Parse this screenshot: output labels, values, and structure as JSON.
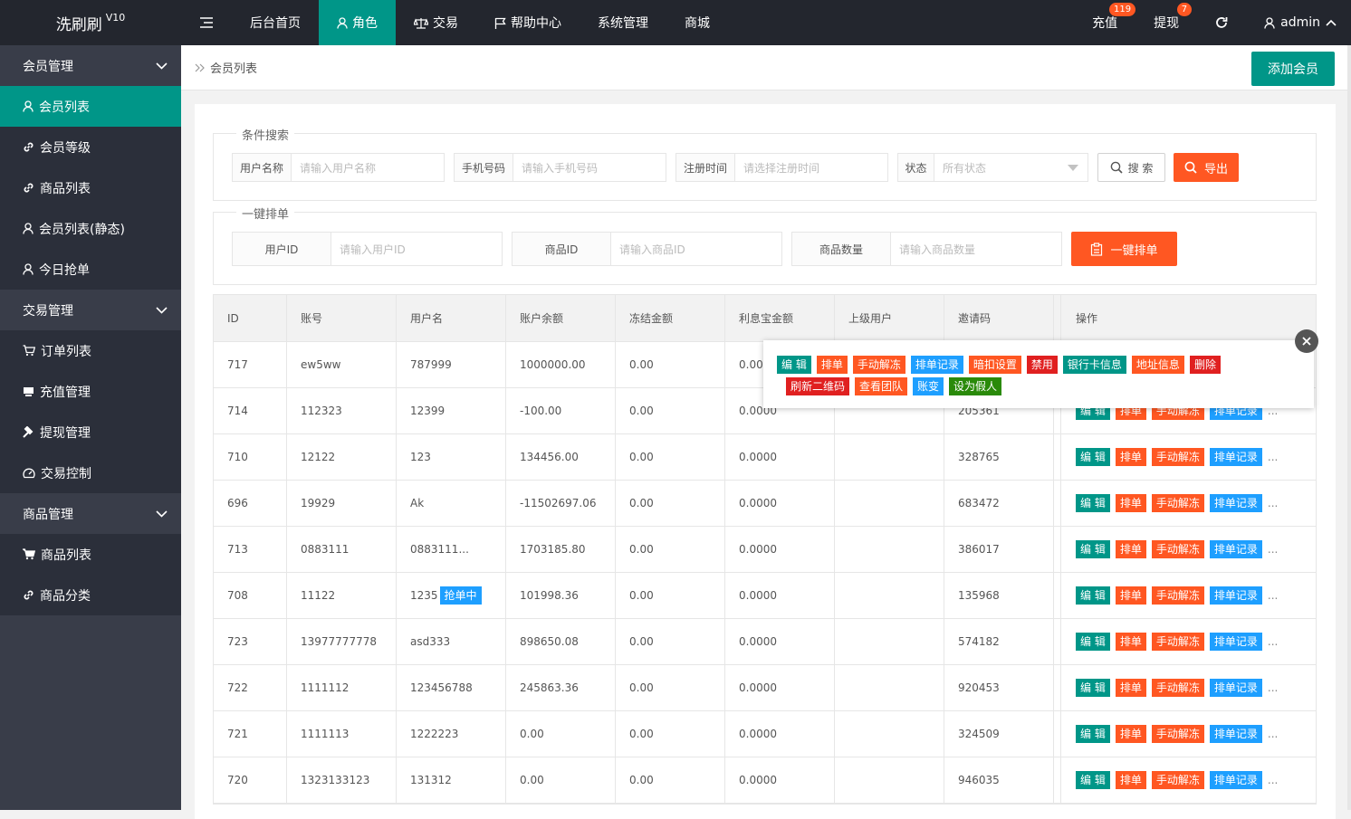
{
  "app": {
    "title": "洗刷刷",
    "version": "V10"
  },
  "nav": [
    {
      "label": "后台首页",
      "icon": ""
    },
    {
      "label": "角色",
      "icon": "user-icon",
      "active": true
    },
    {
      "label": "交易",
      "icon": "scale-icon"
    },
    {
      "label": "帮助中心",
      "icon": "flag-icon"
    },
    {
      "label": "系统管理",
      "icon": ""
    },
    {
      "label": "商城",
      "icon": ""
    }
  ],
  "right_nav": {
    "recharge": {
      "label": "充值",
      "badge": "119"
    },
    "withdraw": {
      "label": "提现",
      "badge": "7"
    },
    "user": "admin"
  },
  "sidebar": {
    "groups": [
      {
        "label": "会员管理",
        "items": [
          {
            "label": "会员列表",
            "icon": "user-icon",
            "active": true
          },
          {
            "label": "会员等级",
            "icon": "link-icon"
          },
          {
            "label": "商品列表",
            "icon": "link-icon"
          },
          {
            "label": "会员列表(静态)",
            "icon": "user-icon"
          },
          {
            "label": "今日抢单",
            "icon": "user-icon"
          }
        ]
      },
      {
        "label": "交易管理",
        "items": [
          {
            "label": "订单列表",
            "icon": "cart-icon"
          },
          {
            "label": "充值管理",
            "icon": "card-icon"
          },
          {
            "label": "提现管理",
            "icon": "hammer-icon"
          },
          {
            "label": "交易控制",
            "icon": "gauge-icon"
          }
        ]
      },
      {
        "label": "商品管理",
        "items": [
          {
            "label": "商品列表",
            "icon": "cart-solid-icon"
          },
          {
            "label": "商品分类",
            "icon": "link-icon"
          }
        ]
      }
    ]
  },
  "breadcrumb": "会员列表",
  "add_button": "添加会员",
  "search": {
    "legend": "条件搜索",
    "fields": [
      {
        "label": "用户名称",
        "placeholder": "请输入用户名称"
      },
      {
        "label": "手机号码",
        "placeholder": "请输入手机号码"
      },
      {
        "label": "注册时间",
        "placeholder": "请选择注册时间"
      },
      {
        "label": "状态",
        "placeholder": "所有状态"
      }
    ],
    "search_button": "搜 索",
    "export_button": "导出"
  },
  "oneclick": {
    "legend": "一键排单",
    "fields": [
      {
        "label": "用户ID",
        "placeholder": "请输入用户ID"
      },
      {
        "label": "商品ID",
        "placeholder": "请输入商品ID"
      },
      {
        "label": "商品数量",
        "placeholder": "请输入商品数量"
      }
    ],
    "button": "一键排单"
  },
  "table": {
    "headers": [
      "ID",
      "账号",
      "用户名",
      "账户余额",
      "冻结金额",
      "利息宝金额",
      "上级用户",
      "邀请码",
      "操作"
    ],
    "rows": [
      {
        "id": "717",
        "account": "ew5ww",
        "username": "787999",
        "balance": "1000000.00",
        "frozen": "0.00",
        "interest": "0.000",
        "parent": "",
        "invite": ""
      },
      {
        "id": "714",
        "account": "112323",
        "username": "12399",
        "balance": "-100.00",
        "frozen": "0.00",
        "interest": "0.0000",
        "parent": "",
        "invite": "205361"
      },
      {
        "id": "710",
        "account": "12122",
        "username": "123",
        "balance": "134456.00",
        "frozen": "0.00",
        "interest": "0.0000",
        "parent": "",
        "invite": "328765"
      },
      {
        "id": "696",
        "account": "19929",
        "username": "Ak",
        "balance": "-11502697.06",
        "frozen": "0.00",
        "interest": "0.0000",
        "parent": "",
        "invite": "683472"
      },
      {
        "id": "713",
        "account": "0883111",
        "username": "0883111...",
        "balance": "1703185.80",
        "frozen": "0.00",
        "interest": "0.0000",
        "parent": "",
        "invite": "386017"
      },
      {
        "id": "708",
        "account": "11122",
        "username": "1235",
        "tag": "抢单中",
        "balance": "101998.36",
        "frozen": "0.00",
        "interest": "0.0000",
        "parent": "",
        "invite": "135968"
      },
      {
        "id": "723",
        "account": "13977777778",
        "username": "asd333",
        "balance": "898650.08",
        "frozen": "0.00",
        "interest": "0.0000",
        "parent": "",
        "invite": "574182"
      },
      {
        "id": "722",
        "account": "1111112",
        "username": "123456788",
        "balance": "245863.36",
        "frozen": "0.00",
        "interest": "0.0000",
        "parent": "",
        "invite": "920453"
      },
      {
        "id": "721",
        "account": "1111113",
        "username": "1222223",
        "balance": "0.00",
        "frozen": "0.00",
        "interest": "0.0000",
        "parent": "",
        "invite": "324509"
      },
      {
        "id": "720",
        "account": "1323133123",
        "username": "131312",
        "balance": "0.00",
        "frozen": "0.00",
        "interest": "0.0000",
        "parent": "",
        "invite": "946035"
      }
    ],
    "row_actions": [
      "编 辑",
      "排单",
      "手动解冻",
      "排单记录"
    ],
    "more": "..."
  },
  "popup_actions": {
    "line1": [
      {
        "label": "编 辑",
        "color": "#009688"
      },
      {
        "label": "排单",
        "color": "#ff5722"
      },
      {
        "label": "手动解冻",
        "color": "#ff5722"
      },
      {
        "label": "排单记录",
        "color": "#1e9fff"
      },
      {
        "label": "暗扣设置",
        "color": "#ff5722"
      },
      {
        "label": "禁用",
        "color": "#e02020"
      },
      {
        "label": "银行卡信息",
        "color": "#009688"
      },
      {
        "label": "地址信息",
        "color": "#ff5722"
      },
      {
        "label": "删除",
        "color": "#e02020"
      }
    ],
    "line2": [
      {
        "label": "刷新二维码",
        "color": "#e02020"
      },
      {
        "label": "查看团队",
        "color": "#ff5722"
      },
      {
        "label": "账变",
        "color": "#1e9fff"
      },
      {
        "label": "设为假人",
        "color": "#2a8a0a"
      }
    ]
  },
  "colors": {
    "accent": "#009688",
    "danger": "#ff5722",
    "info": "#1e9fff",
    "topbar": "#23262e",
    "sidebar": "#393d49"
  }
}
